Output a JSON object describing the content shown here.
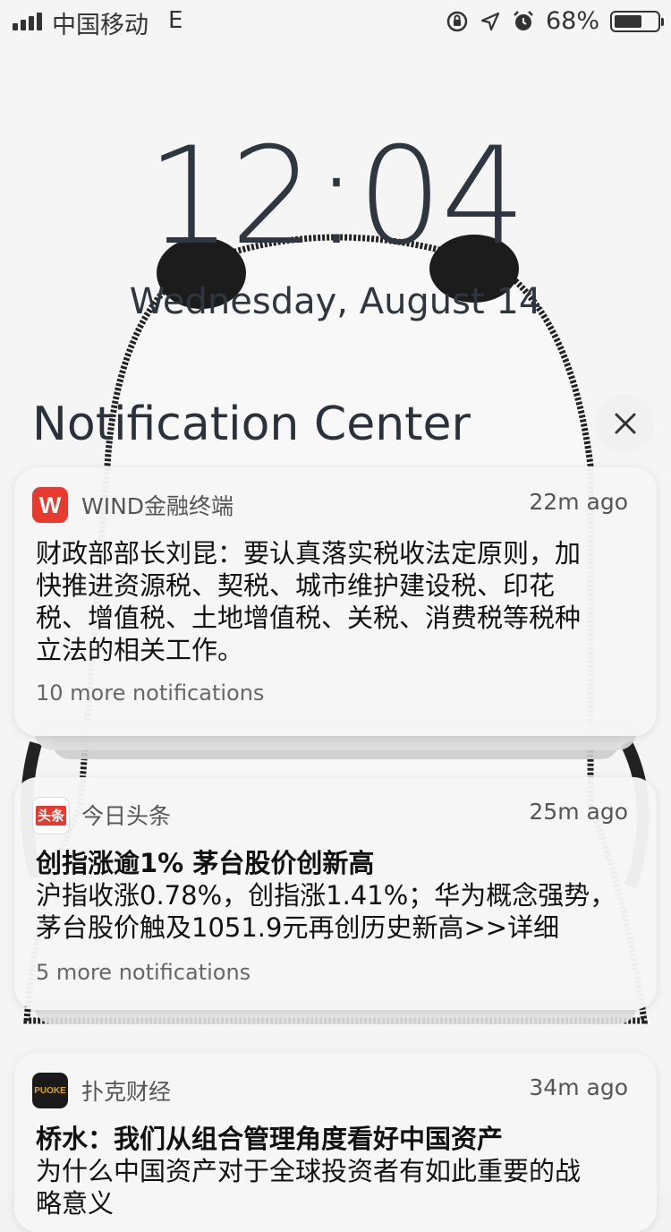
{
  "status_bar": {
    "carrier": "中国移动",
    "network": "E",
    "battery_percent": "68%",
    "battery_level": 0.68
  },
  "lock_screen": {
    "time": "12:04",
    "date": "Wednesday, August 14"
  },
  "notification_center": {
    "title": "Notification Center",
    "close_icon": "close-icon"
  },
  "notifications": [
    {
      "app": "WIND金融终端",
      "icon_text": "W",
      "time_ago": "22m ago",
      "title": "",
      "body_lines": [
        "财政部部长刘昆：要认真落实税收法定原则，加",
        "快推进资源税、契税、城市维护建设税、印花",
        "税、增值税、土地增值税、关税、消费税等税种",
        "立法的相关工作。"
      ],
      "more": "10 more notifications"
    },
    {
      "app": "今日头条",
      "icon_text": "头条",
      "time_ago": "25m ago",
      "title": "创指涨逾1% 茅台股价创新高",
      "body_lines": [
        "沪指收涨0.78%，创指涨1.41%；华为概念强势，",
        "茅台股价触及1051.9元再创历史新高>>详细"
      ],
      "more": "5 more notifications"
    },
    {
      "app": "扑克财经",
      "icon_text": "PUOKE",
      "time_ago": "34m ago",
      "title": "桥水：我们从组合管理角度看好中国资产",
      "body_lines": [
        "为什么中国资产对于全球投资者有如此重要的战",
        "略意义"
      ],
      "more": ""
    }
  ],
  "colors": {
    "wind_red": "#e63b2e",
    "toutiao_red": "#e8392f",
    "puoke_black": "#1a1a1a",
    "puoke_gold": "#d9a420"
  }
}
